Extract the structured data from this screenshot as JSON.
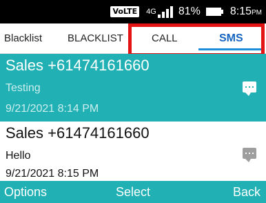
{
  "status_bar": {
    "volte": "VoLTE",
    "network": "4G",
    "battery_percent": "81%",
    "battery_level": 0.81,
    "time": "8:15",
    "time_suffix": "PM"
  },
  "tabs": [
    {
      "label": "Blacklist"
    },
    {
      "label": "BLACKLIST"
    },
    {
      "label": "CALL"
    },
    {
      "label": "SMS",
      "active": true
    }
  ],
  "colors": {
    "accent": "#21b0b4",
    "highlight_box": "#e51414",
    "active_tab_text": "#1565c0",
    "tab_underline": "#1a8fd8"
  },
  "messages": [
    {
      "sender": "Sales +61474161660",
      "body": "Testing",
      "time": "9/21/2021 8:14 PM",
      "selected": true,
      "icon": "chat-bubble-icon"
    },
    {
      "sender": "Sales +61474161660",
      "body": "Hello",
      "time": "9/21/2021 8:15 PM",
      "selected": false,
      "icon": "chat-bubble-icon"
    }
  ],
  "softkeys": {
    "left": "Options",
    "center": "Select",
    "right": "Back"
  }
}
